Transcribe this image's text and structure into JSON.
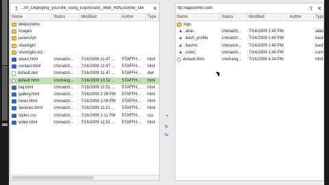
{
  "left": {
    "path": "...0h_Deploying_yoursite_using_Expression_Web_4\\tf\\Lucerne_site",
    "columns": [
      "Name",
      "Status",
      "Modified",
      "Author",
      "Type"
    ],
    "rows": [
      {
        "icon": "folder",
        "name": "deepzooms",
        "status": "",
        "modified": "",
        "author": "",
        "type": ""
      },
      {
        "icon": "folder",
        "name": "images",
        "status": "",
        "modified": "",
        "author": "",
        "type": ""
      },
      {
        "icon": "folder",
        "name": "javascript",
        "status": "",
        "modified": "",
        "author": "",
        "type": ""
      },
      {
        "icon": "folder",
        "name": "silverlight",
        "status": "",
        "modified": "",
        "author": "",
        "type": ""
      },
      {
        "icon": "folder",
        "name": "silverlight-vid...",
        "status": "",
        "modified": "",
        "author": "",
        "type": ""
      },
      {
        "icon": "html",
        "name": "about.html",
        "status": "Unmatch...",
        "modified": "7/16/2009 11:47 ...",
        "author": "STAFFH...",
        "type": "html"
      },
      {
        "icon": "html",
        "name": "contact.html",
        "status": "Unmatch...",
        "modified": "7/16/2009 11:47 ...",
        "author": "STAFFH...",
        "type": "html"
      },
      {
        "icon": "file",
        "name": "default.dwt",
        "status": "Unmatch...",
        "modified": "7/16/2009 11:47 ...",
        "author": "STAFFH...",
        "type": "dwt"
      },
      {
        "icon": "doc",
        "name": "default.html",
        "status": "Unchang...",
        "modified": "7/16/2009 10:52 ...",
        "author": "STAFFH...",
        "type": "html",
        "selected": true
      },
      {
        "icon": "html",
        "name": "faq.html",
        "status": "Unmatch...",
        "modified": "7/16/2009 11:51 ...",
        "author": "STAFFH...",
        "type": "html"
      },
      {
        "icon": "html",
        "name": "gallery.html",
        "status": "Unmatch...",
        "modified": "7/16/2009 2:38 PM",
        "author": "STAFFH...",
        "type": "html"
      },
      {
        "icon": "html",
        "name": "news.html",
        "status": "Unmatch...",
        "modified": "7/16/2009 1:08 PM",
        "author": "STAFFH...",
        "type": "html"
      },
      {
        "icon": "html",
        "name": "services.html",
        "status": "Unmatch...",
        "modified": "7/16/2009 11:51 ...",
        "author": "STAFFH...",
        "type": "html"
      },
      {
        "icon": "html",
        "name": "styles.css",
        "status": "Unmatch...",
        "modified": "7/16/2009 2:11 PM",
        "author": "STAFFH...",
        "type": "css"
      },
      {
        "icon": "html",
        "name": "video.html",
        "status": "Unmatch...",
        "modified": "7/16/2009 11:51 ...",
        "author": "STAFFH...",
        "type": "html"
      }
    ]
  },
  "right": {
    "path": "ftp://agaserver.com",
    "columns": [
      "Name",
      "Status",
      "Modified",
      "Author",
      "Type"
    ],
    "rows": [
      {
        "icon": "folder",
        "name": "logs",
        "status": "",
        "modified": "",
        "author": "",
        "type": ""
      },
      {
        "icon": "up",
        "name": ".alias",
        "status": "Unmatch...",
        "modified": "7/14/2009 1:40 PM",
        "author": "",
        "type": "alias"
      },
      {
        "icon": "up",
        "name": ".bash_profile",
        "status": "Unmatch...",
        "modified": "7/14/2009 1:40 PM",
        "author": "",
        "type": "bash"
      },
      {
        "icon": "up",
        "name": ".bashrc",
        "status": "Unmatch...",
        "modified": "7/14/2009 1:40 PM",
        "author": "",
        "type": "bash"
      },
      {
        "icon": "up",
        "name": ".cshrc",
        "status": "Unmatch...",
        "modified": "7/14/2009 1:40 PM",
        "author": "",
        "type": "cshrc"
      },
      {
        "icon": "doc",
        "name": "default.html",
        "status": "Unchang...",
        "modified": "7/16/2009 4:34 PM",
        "author": "",
        "type": "html"
      }
    ]
  },
  "icons": {
    "up_folder": "folder-up-icon",
    "close": "close-icon",
    "refresh": "refresh-icon"
  }
}
